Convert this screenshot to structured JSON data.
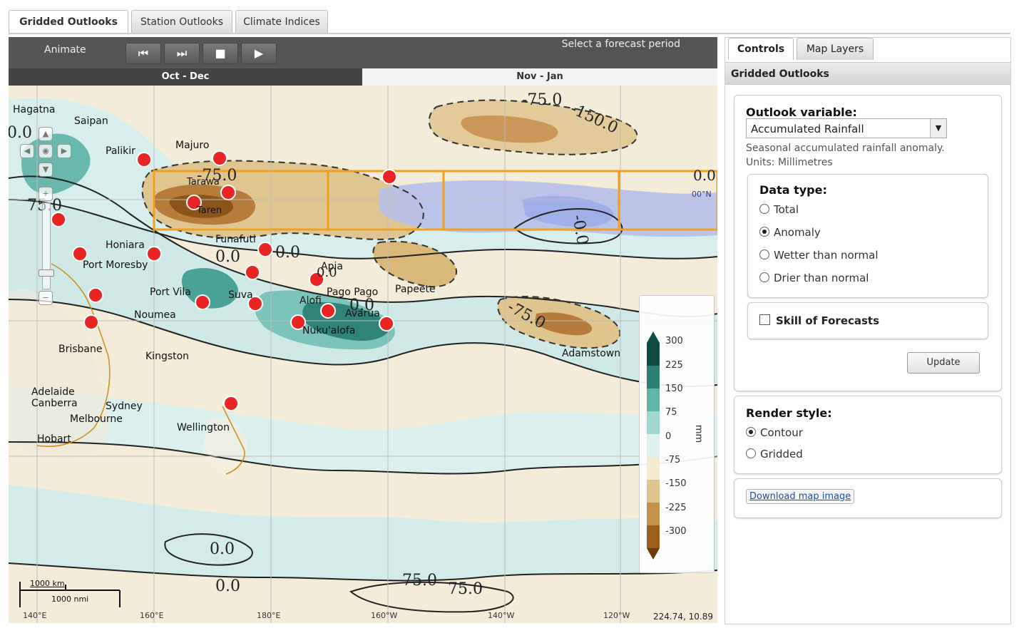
{
  "tabs": [
    {
      "label": "Gridded Outlooks",
      "active": true
    },
    {
      "label": "Station Outlooks",
      "active": false
    },
    {
      "label": "Climate Indices",
      "active": false
    }
  ],
  "toolbar": {
    "animate_label": "Animate",
    "buttons": [
      "skip-back-icon",
      "step-forward-icon",
      "stop-icon",
      "play-icon"
    ],
    "forecast_label": "Select a forecast period"
  },
  "periods": [
    {
      "label": "Oct - Dec",
      "selected": true
    },
    {
      "label": "Nov - Jan",
      "selected": false
    }
  ],
  "map": {
    "cities": [
      "Hagatna",
      "Saipan",
      "Palikir",
      "Majuro",
      "Tarawa",
      "Taren",
      "Funafuti",
      "Honiara",
      "Port Moresby",
      "Port Vila",
      "Suva",
      "Apia",
      "Pago Pago",
      "Papeete",
      "Alofi",
      "Avarua",
      "Nuku'alofa",
      "Noumea",
      "Brisbane",
      "Kingston",
      "Adamstown",
      "Adelaide",
      "Canberra",
      "Sydney",
      "Melbourne",
      "Hobart",
      "Wellington"
    ],
    "contour_labels": [
      "-75.0",
      "-150.0",
      "0.0",
      "-75.0",
      "0.0",
      "0.0",
      "0.0",
      "75.0",
      "-0.0",
      "0.0",
      "-75.0",
      "0.0",
      "0.0",
      "75.0",
      "75.0",
      "0.0",
      "00°N"
    ],
    "lon_labels": [
      "140°E",
      "160°E",
      "180°E",
      "160°W",
      "140°W",
      "120°W"
    ],
    "coords": "224.74, 10.89",
    "scale_km": "1000 km",
    "scale_nmi": "1000 nmi"
  },
  "legend": {
    "ticks": [
      "300",
      "225",
      "150",
      "75",
      "0",
      "-75",
      "-150",
      "-225",
      "-300"
    ],
    "unit": "mm",
    "colors": [
      "#0d4d43",
      "#2b7f73",
      "#5fb6a7",
      "#9fd8ce",
      "#dff1ee",
      "#f3ead0",
      "#e0c48e",
      "#c4914b",
      "#9a5e1f",
      "#6b3a0d"
    ]
  },
  "side": {
    "tabs": [
      {
        "label": "Controls",
        "active": true
      },
      {
        "label": "Map Layers",
        "active": false
      }
    ],
    "header": "Gridded Outlooks",
    "outlook_label": "Outlook variable:",
    "outlook_value": "Accumulated Rainfall",
    "outlook_desc_1": "Seasonal accumulated rainfall anomaly.",
    "outlook_desc_2": "Units: Millimetres",
    "datatype_label": "Data type:",
    "datatype_options": [
      {
        "label": "Total",
        "checked": false
      },
      {
        "label": "Anomaly",
        "checked": true
      },
      {
        "label": "Wetter than normal",
        "checked": false
      },
      {
        "label": "Drier than normal",
        "checked": false
      }
    ],
    "skill_label": "Skill of Forecasts",
    "update_label": "Update",
    "render_label": "Render style:",
    "render_options": [
      {
        "label": "Contour",
        "checked": true
      },
      {
        "label": "Gridded",
        "checked": false
      }
    ],
    "download_label": "Download map image"
  }
}
